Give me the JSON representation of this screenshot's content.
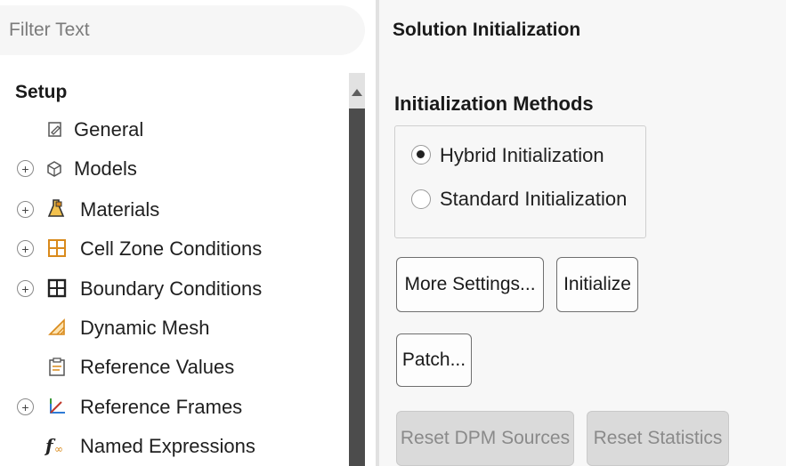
{
  "filter": {
    "placeholder": "Filter Text"
  },
  "tree": {
    "heading": "Setup",
    "items": [
      {
        "label": "General",
        "icon": "general-icon",
        "expandable": false
      },
      {
        "label": "Models",
        "icon": "models-icon",
        "expandable": true
      },
      {
        "label": "Materials",
        "icon": "materials-icon",
        "expandable": true
      },
      {
        "label": "Cell Zone Conditions",
        "icon": "cell-zone-icon",
        "expandable": true
      },
      {
        "label": "Boundary Conditions",
        "icon": "boundary-icon",
        "expandable": true
      },
      {
        "label": "Dynamic Mesh",
        "icon": "dynamic-mesh-icon",
        "expandable": false
      },
      {
        "label": "Reference Values",
        "icon": "reference-values-icon",
        "expandable": false
      },
      {
        "label": "Reference Frames",
        "icon": "reference-frames-icon",
        "expandable": true
      },
      {
        "label": "Named Expressions",
        "icon": "named-expressions-icon",
        "expandable": false
      }
    ],
    "expander_symbol": "+"
  },
  "panel": {
    "title": "Solution Initialization",
    "group_title": "Initialization Methods",
    "options": [
      {
        "label": "Hybrid  Initialization",
        "checked": true
      },
      {
        "label": "Standard Initialization",
        "checked": false
      }
    ],
    "buttons": {
      "more_settings": "More Settings...",
      "initialize": "Initialize",
      "patch": "Patch...",
      "reset_dpm": "Reset DPM Sources",
      "reset_statistics": "Reset Statistics"
    }
  },
  "colors": {
    "panel_bg": "#f7f7f7",
    "scroll_thumb": "#4c4c4c",
    "disabled_button": "#dadada",
    "icon_orange": "#d98a1c",
    "icon_red": "#c0392b",
    "icon_blue": "#2e7bd6",
    "icon_green": "#3a9a3a"
  }
}
